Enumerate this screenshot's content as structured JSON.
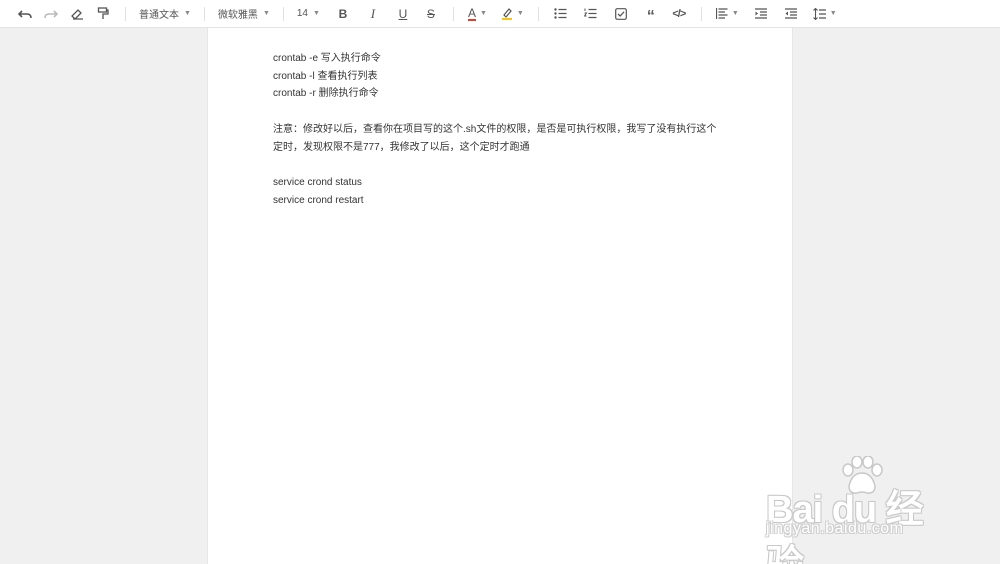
{
  "toolbar": {
    "paragraph_style": "普通文本",
    "font_family": "微软雅黑",
    "font_size": "14",
    "bold_glyph": "B",
    "italic_glyph": "I",
    "underline_glyph": "U",
    "strike_glyph": "S",
    "font_color_glyph": "A",
    "quote_glyph": "“",
    "code_glyph": "</>"
  },
  "colors": {
    "font_color_indicator": "#e03e2d",
    "highlight_indicator": "#f5c518"
  },
  "document": {
    "lines": [
      "crontab -e 写入执行命令",
      "crontab -l 查看执行列表",
      "crontab -r 删除执行命令",
      "",
      "注意：修改好以后，查看你在项目写的这个.sh文件的权限，是否是可执行权限，我写了没有执行这个",
      "定时，发现权限不是777，我修改了以后，这个定时才跑通",
      "",
      "service crond status",
      "service crond restart"
    ]
  },
  "watermark": {
    "logo_text": "Bai du 经验",
    "url": "jingyan.baidu.com"
  }
}
